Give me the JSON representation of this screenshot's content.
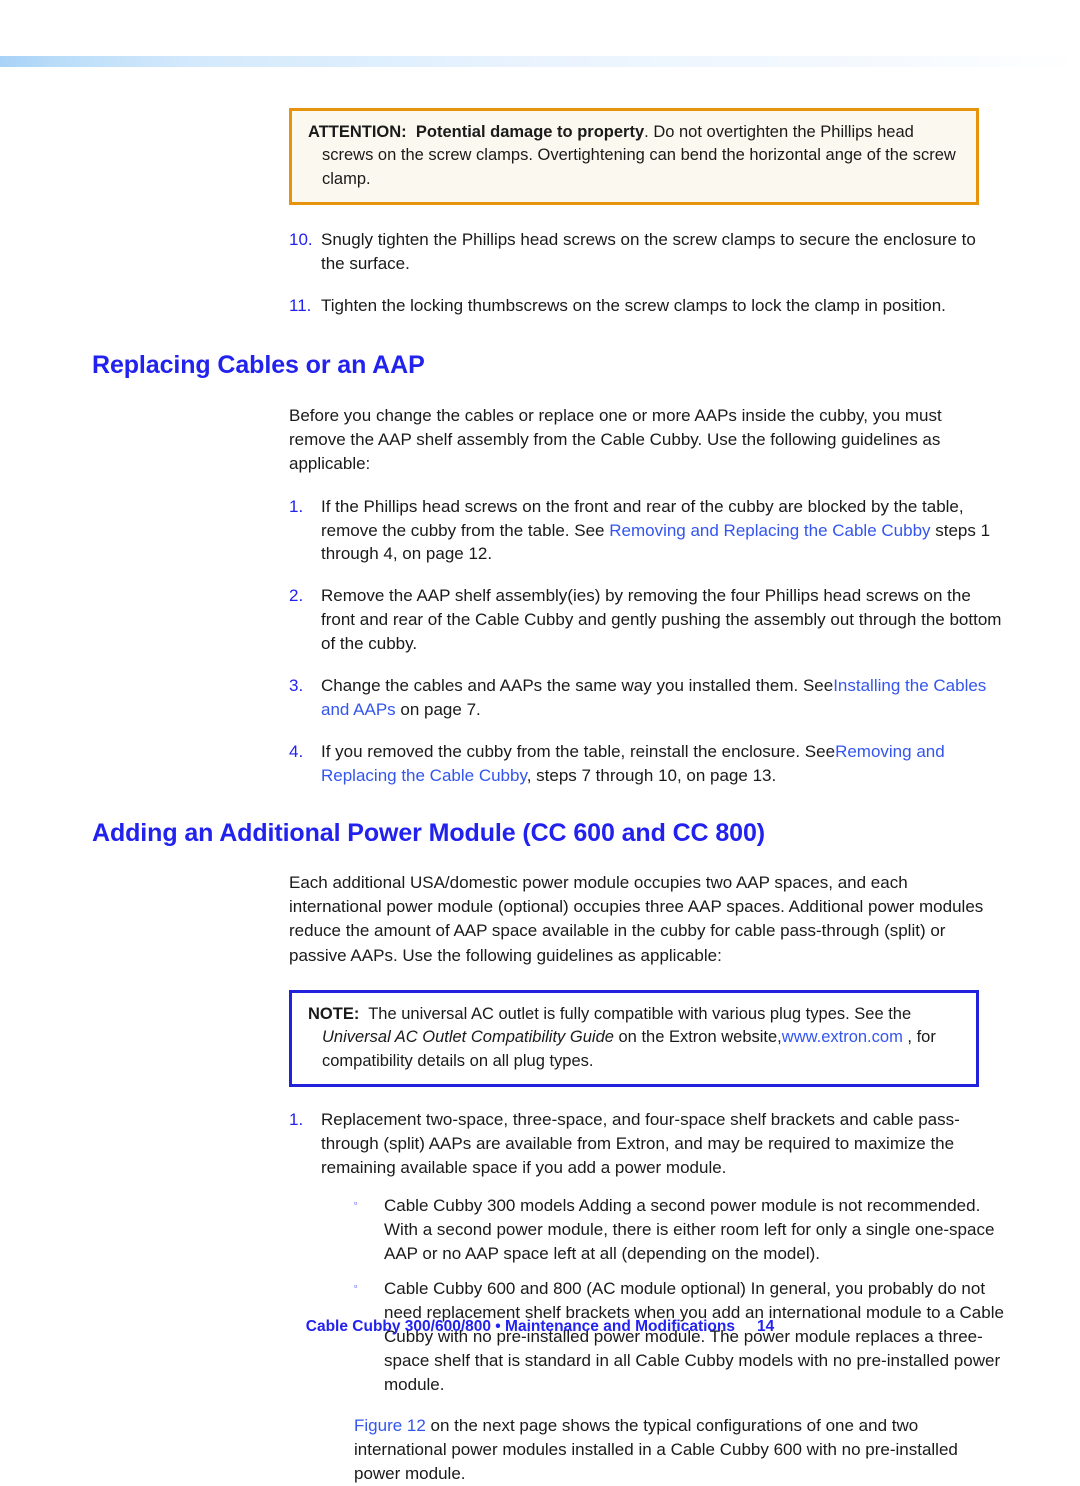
{
  "document": {
    "top_band": "decorative-gradient-band"
  },
  "attention_box": {
    "label": "ATTENTION:",
    "bold_lead": "Potential damage to property",
    "text_part1": ". Do not overtighten the Phillips head screws on the screw clamps. Overtightening can bend the horizontal",
    "text_overflow": " ange of",
    "text_part2": "the screw clamp.",
    "border_color": "#e8930c",
    "background_color": "#fbf8ef"
  },
  "top_steps": [
    {
      "number": "10.",
      "text": "Snugly tighten the Phillips head screws on the screw clamps to secure the enclosure to the surface."
    },
    {
      "number": "11.",
      "text": "Tighten the locking thumbscrews on the screw clamps to lock the clamp in position."
    }
  ],
  "section_1": {
    "heading": "Replacing Cables or an AAP",
    "intro": "Before you change the cables or replace one or more AAPs inside the cubby, you must remove the AAP shelf assembly from the Cable Cubby. Use the following guidelines as applicable:",
    "steps": [
      {
        "number": "1.",
        "pre": "If the Phillips head screws on the front and rear of the cubby are blocked by the table, remove the cubby from the table. See ",
        "link": "Removing and Replacing the Cable Cubby",
        "post": " steps 1 through 4, on page 12."
      },
      {
        "number": "2.",
        "pre": "Remove the AAP shelf assembly(ies) by removing the four Phillips head screws on the front and rear of the Cable Cubby and gently pushing the assembly out through the bottom of the cubby.",
        "link": "",
        "post": ""
      },
      {
        "number": "3.",
        "pre": "Change the cables and AAPs the same way you installed them. See",
        "link": "Installing the Cables and AAPs",
        "post": " on page 7."
      },
      {
        "number": "4.",
        "pre": "If you removed the cubby from the table, reinstall the enclosure. See",
        "link": "Removing and Replacing the Cable Cubby",
        "post": ", steps 7 through 10, on page 13."
      }
    ]
  },
  "section_2": {
    "heading": "Adding an Additional Power Module (CC 600 and CC 800)",
    "intro": "Each additional USA/domestic power module occupies two AAP spaces, and each international power module (optional) occupies three AAP spaces. Additional power modules reduce the amount of AAP space available in the cubby for cable pass-through (split) or passive AAPs. Use the following guidelines as applicable:",
    "note_box": {
      "label": "NOTE:",
      "text_part1": "The universal AC outlet is fully compatible with various plug types. See the ",
      "italic_title": "Universal AC Outlet Compatibility Guide",
      "text_part2": " on the Extron website,",
      "link": "www.extron.com",
      "text_part3": "  , for compatibility details on all plug types.",
      "border_color": "#2222dd",
      "background_color": "#ffffff"
    },
    "steps": [
      {
        "number": "1.",
        "text": "Replacement two-space, three-space, and four-space shelf brackets and cable pass-through (split) AAPs are available from Extron, and may be required to maximize the  remaining available space if you add a power module."
      }
    ],
    "sub_bullets": [
      {
        "marker": "square-bullet",
        "text": "Cable Cubby 300 models     Adding a second power module is  not recommended. With a second power module, there is either room left for only a single one-space AAP or no AAP space left at all (depending on the model)."
      },
      {
        "marker": "square-bullet",
        "text": "Cable Cubby 600 and 800 (AC module optional)     In general, you probably  do not  need replacement shelf brackets when you add an international module to a Cable Cubby with no pre-installed power module. The power module replaces a three-space shelf that is standard in all Cable Cubby models with no pre-installed power module."
      }
    ],
    "figure_paragraph": {
      "link": "Figure 12",
      "text": " on the next page shows the typical configurations of one and two international power modules installed in a Cable Cubby 600 with no pre-installed power module."
    }
  },
  "footer": {
    "text": "Cable Cubby 300/600/800 • Maintenance and Modifications",
    "page_number": "14"
  },
  "colors": {
    "heading_blue": "#2222ee",
    "link_blue": "#3355ee",
    "attention_orange": "#e8930c",
    "note_blue": "#2222dd"
  }
}
